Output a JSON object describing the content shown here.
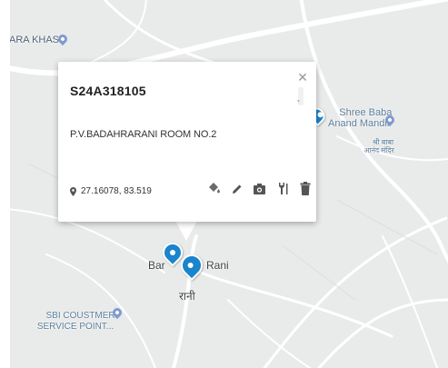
{
  "map": {
    "places": [
      {
        "name": "ARA KHAS",
        "has_pin": true
      },
      {
        "name": "Shree Baba\nAnand Mandir",
        "has_pin": true
      },
      {
        "name": "श्री बाबा\nआनंद मंदिर",
        "has_pin": false
      },
      {
        "name": "Bar",
        "has_pin": false
      },
      {
        "name": "Rani",
        "has_pin": false
      },
      {
        "name": "रानी",
        "has_pin": false
      },
      {
        "name": "SBI COUSTMER\nSERVICE POINT...",
        "has_pin": true
      }
    ],
    "colors": {
      "background": "#e9eaea",
      "road": "#ffffff",
      "marker": "#1a84cc",
      "poi": "#7f9ad0"
    }
  },
  "popup": {
    "title": "S24A318105",
    "address": "P.V.BADAHRARANI ROOM NO.2",
    "coordinates": "27.16078, 83.519",
    "close_icon": "close-icon",
    "actions": [
      {
        "name": "paint-bucket-icon"
      },
      {
        "name": "edit-pencil-icon"
      },
      {
        "name": "camera-icon"
      },
      {
        "name": "tools-icon"
      },
      {
        "name": "delete-trash-icon"
      }
    ]
  }
}
